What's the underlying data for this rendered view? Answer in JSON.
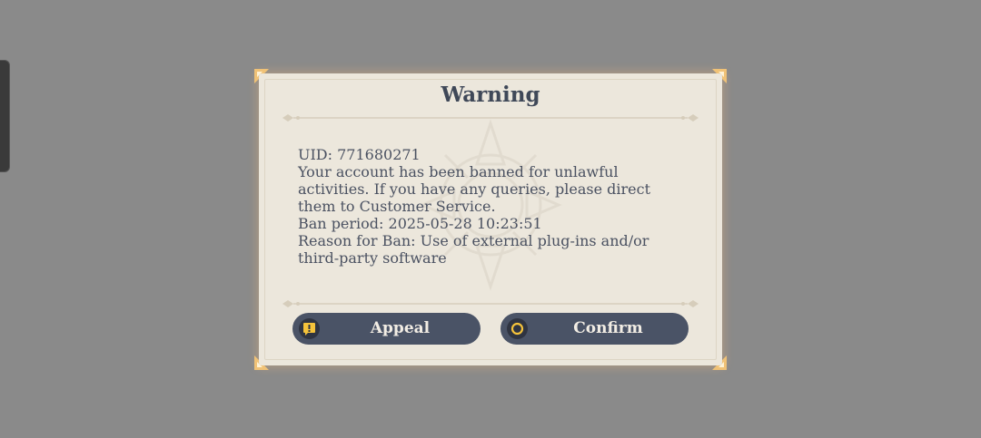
{
  "dialog": {
    "title": "Warning",
    "body_lines": [
      "UID: 771680271",
      "Your account has been banned for unlawful",
      "activities. If you have any queries, please direct",
      "them to Customer Service.",
      "Ban period: 2025-05-28 10:23:51",
      "Reason for Ban: Use of external plug-ins and/or",
      "third-party software"
    ],
    "buttons": {
      "appeal": {
        "label": "Appeal",
        "icon": "exclamation-icon"
      },
      "confirm": {
        "label": "Confirm",
        "icon": "circle-icon"
      }
    }
  },
  "colors": {
    "backdrop": "#8a8a8a",
    "dialog_bg": "#ece7dc",
    "button_bg": "#4a5366",
    "accent": "#f5c33b",
    "text": "#4a5161"
  }
}
